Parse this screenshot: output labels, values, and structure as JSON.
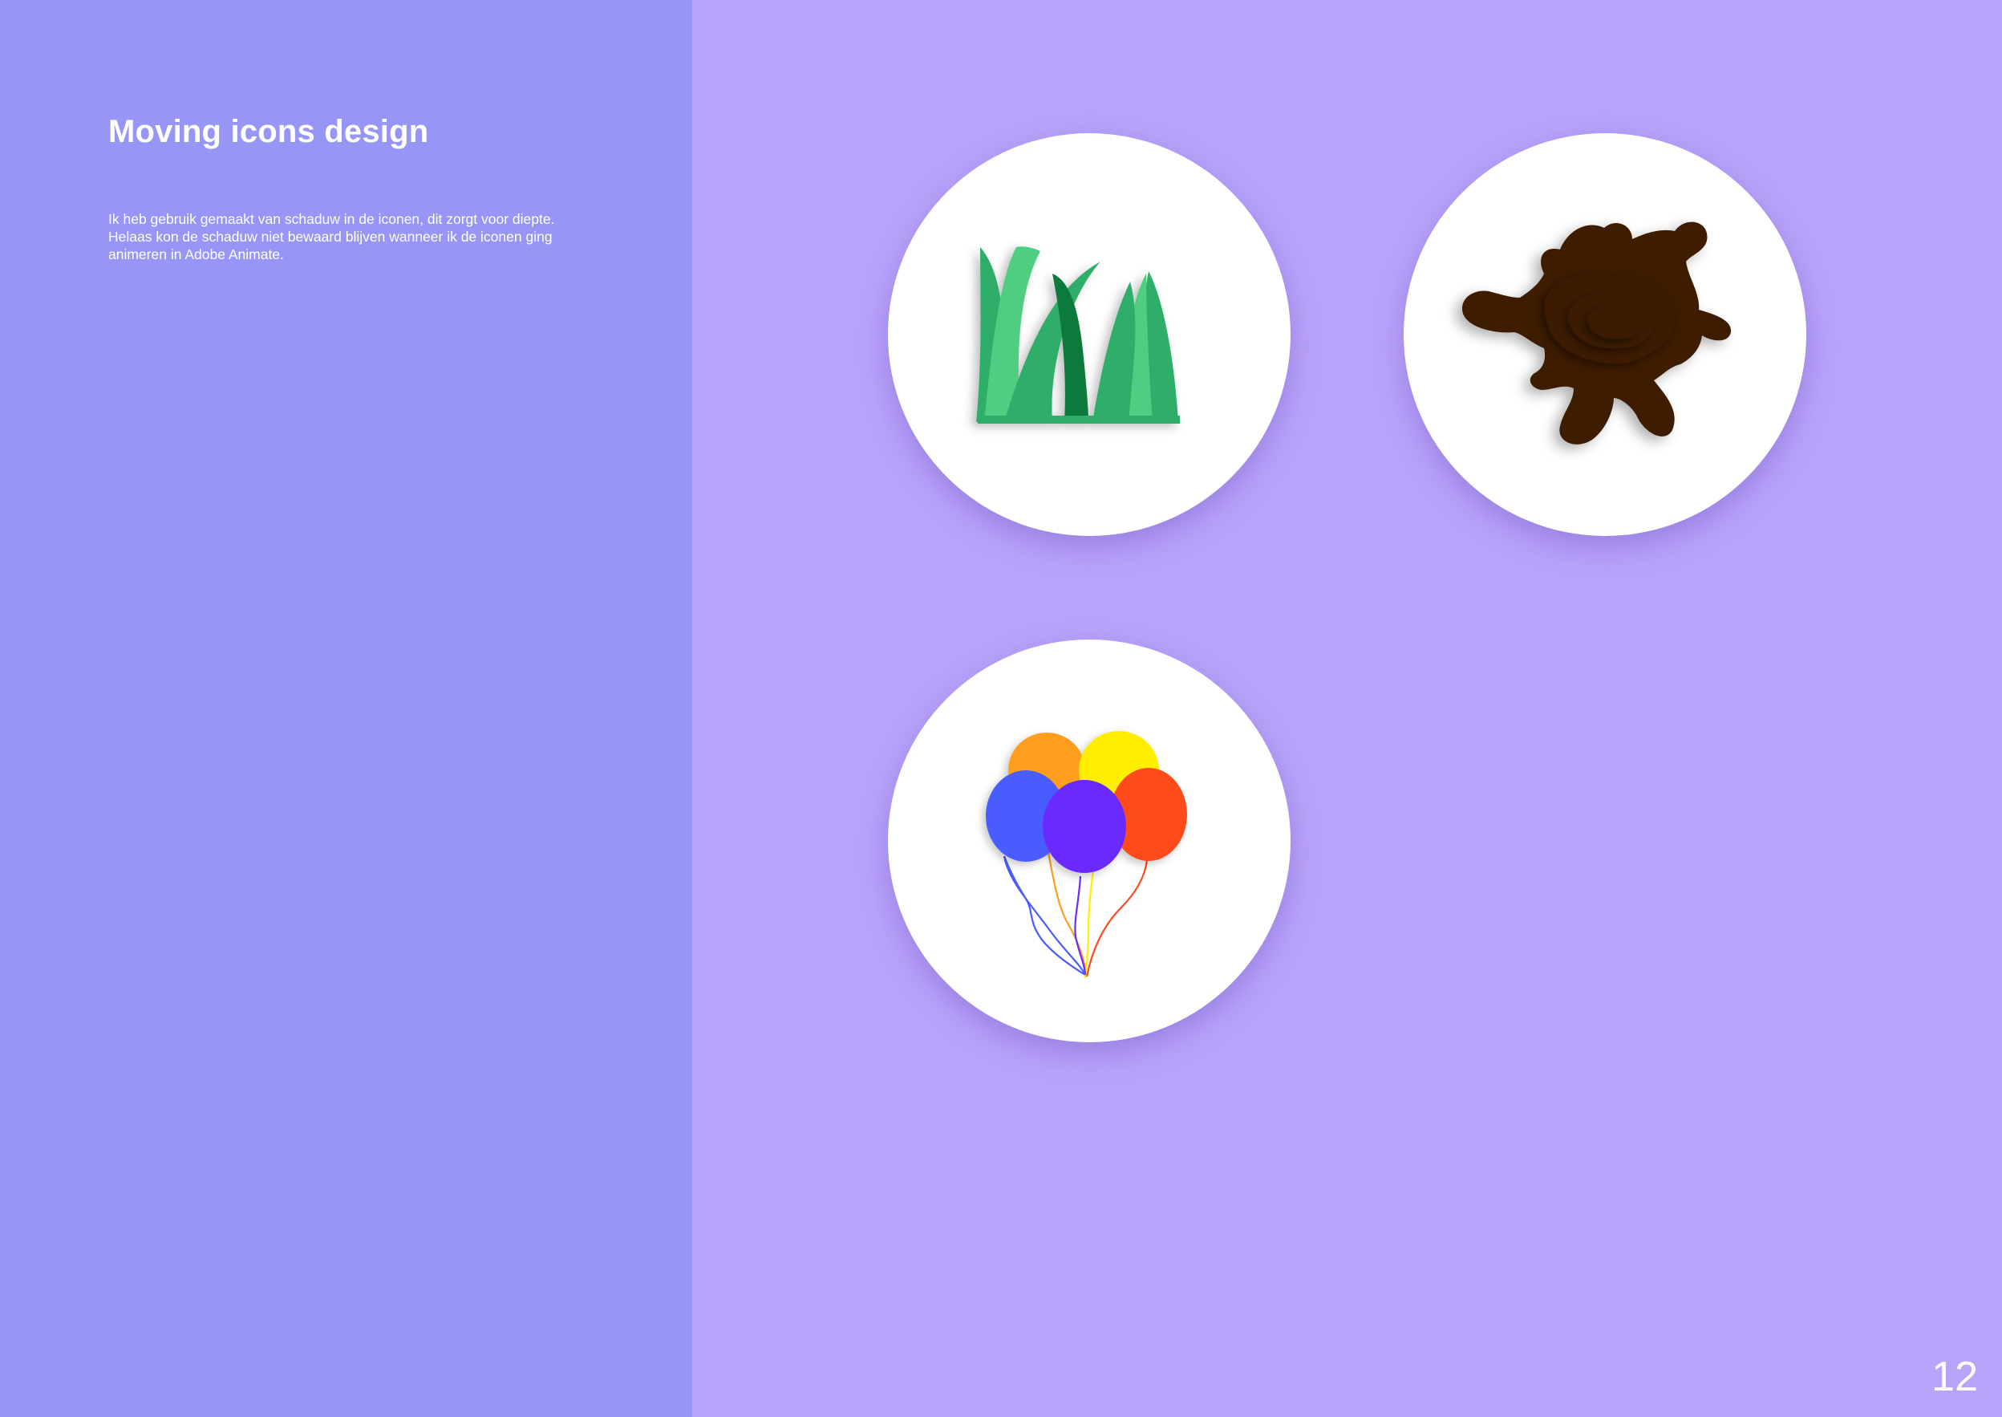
{
  "page": {
    "title": "Moving icons design",
    "description_lines": [
      "Ik heb gebruik gemaakt van schaduw in de iconen, dit zorgt voor diepte.",
      "Helaas kon de schaduw niet bewaard blijven wanneer ik de iconen ging",
      "animeren in Adobe Animate."
    ],
    "page_number": "12"
  },
  "colors": {
    "left_panel": "#9795f5",
    "right_panel": "#b9a4fc",
    "circle": "#ffffff",
    "grass_light": "#4fce82",
    "grass_mid": "#2fae68",
    "grass_dark": "#0d7a3d",
    "mud": "#3d1c06",
    "balloon_orange": "#ff9d1a",
    "balloon_yellow": "#ffee00",
    "balloon_red": "#ff4b1f",
    "balloon_blue": "#4a5bff",
    "balloon_purple": "#6b2cff"
  },
  "icons": [
    {
      "name": "grass-icon"
    },
    {
      "name": "mud-splash-icon"
    },
    {
      "name": "balloons-icon"
    }
  ]
}
